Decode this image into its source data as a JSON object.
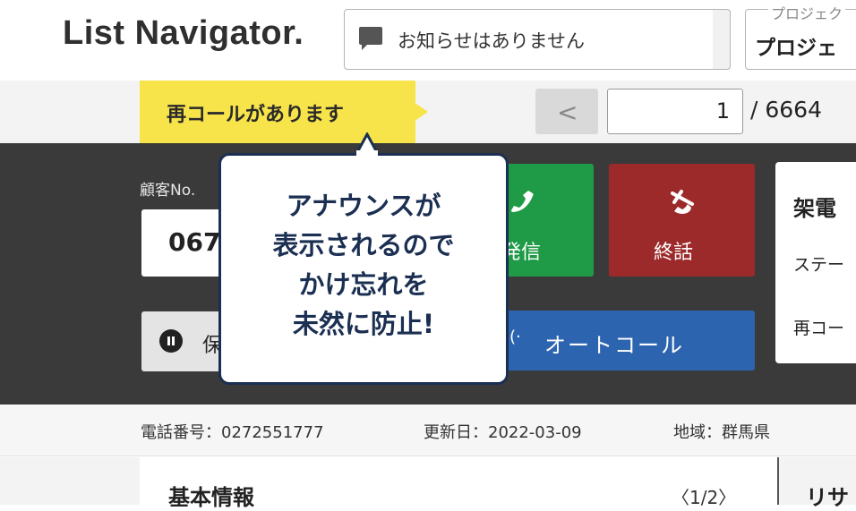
{
  "header": {
    "logo": "List Navigator.",
    "notice": "お知らせはありません",
    "project_label": "プロジェク",
    "project_value": "プロジェ"
  },
  "pager": {
    "recall_badge": "再コールがあります",
    "prev_icon": "<",
    "current_page": "1",
    "total": "/ 6664"
  },
  "customer": {
    "label": "顧客No.",
    "value": "067"
  },
  "buttons": {
    "hold": "保",
    "call": "発信",
    "hangup": "終話",
    "autocall": "オートコール",
    "autocall_icon": "((·"
  },
  "status_panel": {
    "title": "架電",
    "line1": "ステー",
    "line2": "再コー"
  },
  "callout": {
    "line1": "アナウンスが",
    "line2": "表示されるので",
    "line3": "かけ忘れを",
    "line4": "未然に防止!"
  },
  "info": {
    "phone": "電話番号：0272551777",
    "updated": "更新日：2022-03-09",
    "region": "地域：群馬県"
  },
  "bottom": {
    "basic_title": "基本情報",
    "basic_pager": "〈1/2〉",
    "right_title": "リサ"
  },
  "colors": {
    "recall_yellow": "#f7e34a",
    "call_green": "#1f9a47",
    "hangup_red": "#9c2a2a",
    "autocall_blue": "#2d64b0",
    "callout_navy": "#1b2f52",
    "panel_dark": "#3a3a3a"
  },
  "icons": [
    "chat-icon",
    "phone-icon",
    "hangup-icon",
    "pause-icon",
    "broadcast-icon",
    "chevron-left-icon"
  ]
}
